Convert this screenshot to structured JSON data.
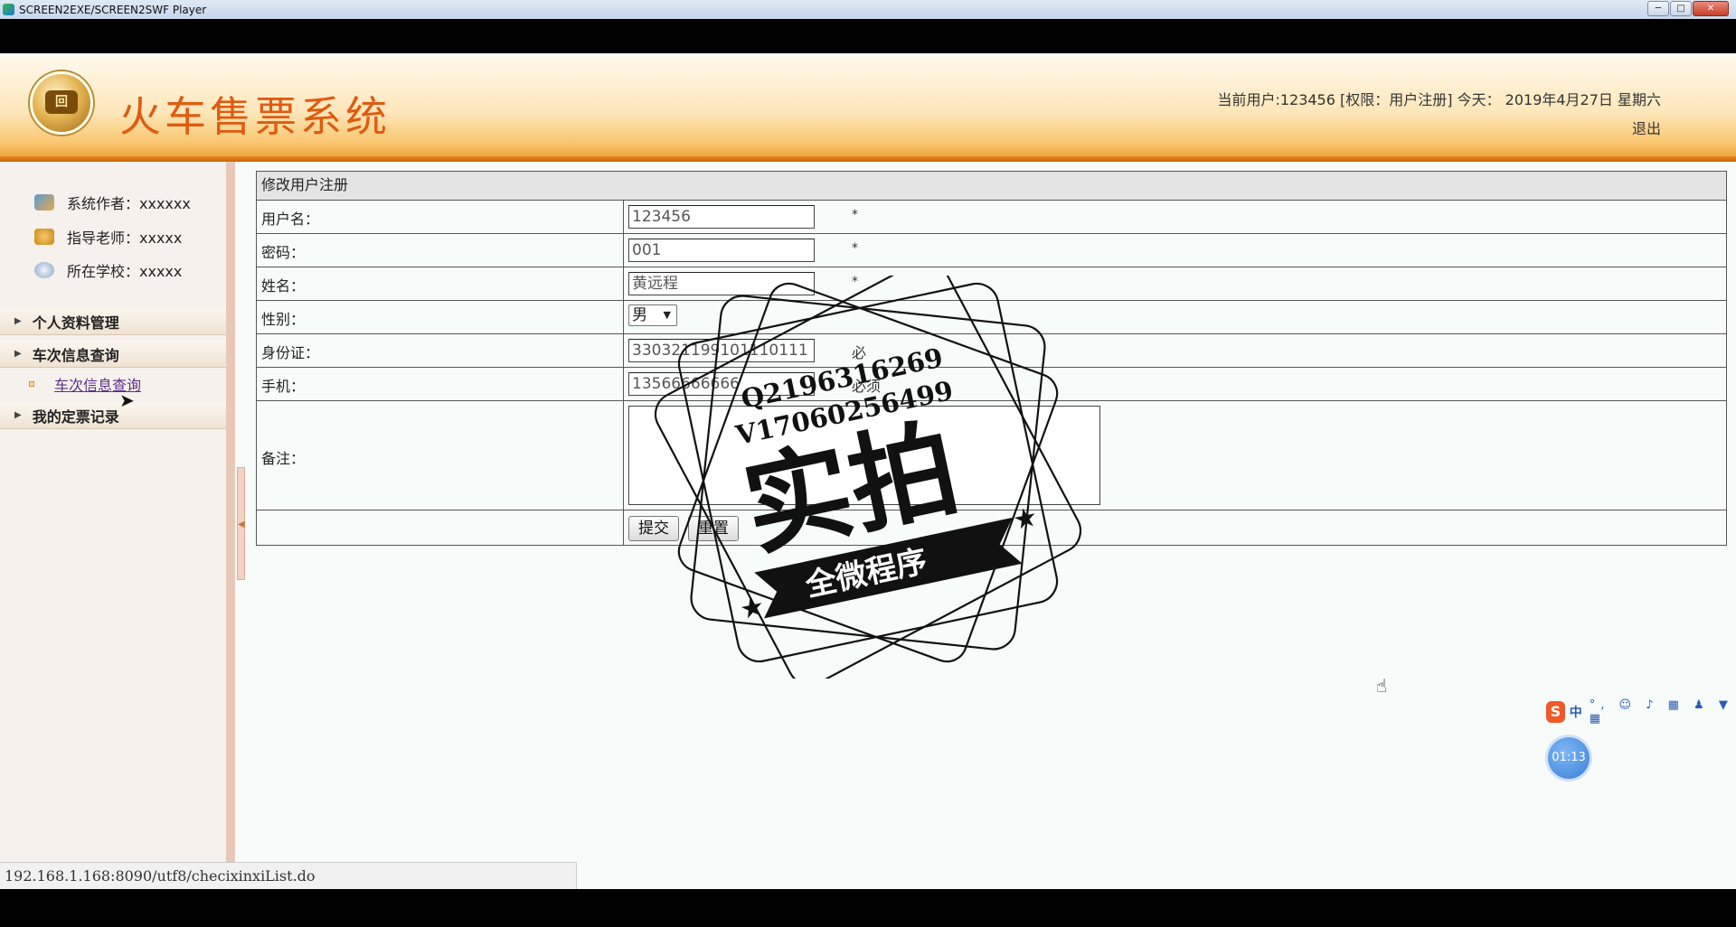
{
  "window": {
    "title": "SCREEN2EXE/SCREEN2SWF Player"
  },
  "header": {
    "logo_text": "回",
    "title": "火车售票系统",
    "user_info": "当前用户:123456 [权限：用户注册] 今天： 2019年4月27日 星期六",
    "logout": "退出"
  },
  "sidebar": {
    "info": [
      {
        "label": "系统作者：xxxxxx",
        "icon": "users-icon"
      },
      {
        "label": "指导老师：xxxxx",
        "icon": "phone-icon"
      },
      {
        "label": "所在学校：xxxxx",
        "icon": "clock-icon"
      }
    ],
    "menu": [
      {
        "label": "个人资料管理"
      },
      {
        "label": "车次信息查询",
        "sub": [
          {
            "label": "车次信息查询"
          }
        ]
      },
      {
        "label": "我的定票记录"
      }
    ]
  },
  "form": {
    "title": "修改用户注册",
    "fields": {
      "username": {
        "label": "用户名：",
        "value": "123456",
        "required": "*"
      },
      "password": {
        "label": "密码：",
        "value": "001",
        "required": "*"
      },
      "name": {
        "label": "姓名：",
        "value": "黄远程",
        "required": "*"
      },
      "gender": {
        "label": "性别：",
        "value": "男"
      },
      "idcard": {
        "label": "身份证：",
        "value": "330321199101110111",
        "hint": "必"
      },
      "phone": {
        "label": "手机：",
        "value": "13566666666",
        "hint": "必须"
      },
      "remark": {
        "label": "备注：",
        "value": ""
      }
    },
    "submit": "提交",
    "reset": "重置"
  },
  "statusbar": {
    "url": "192.168.1.168:8090/utf8/checixinxiList.do"
  },
  "ime": {
    "logo": "S",
    "mode": "中",
    "tools": "°, ☺ ♪ ▦ ♟ ▼ ▦"
  },
  "timer": {
    "value": "01:13"
  },
  "stamp": {
    "contact1": "Q2196316269",
    "contact2": "V17060256499",
    "main": "实拍",
    "banner": "全微程序"
  }
}
